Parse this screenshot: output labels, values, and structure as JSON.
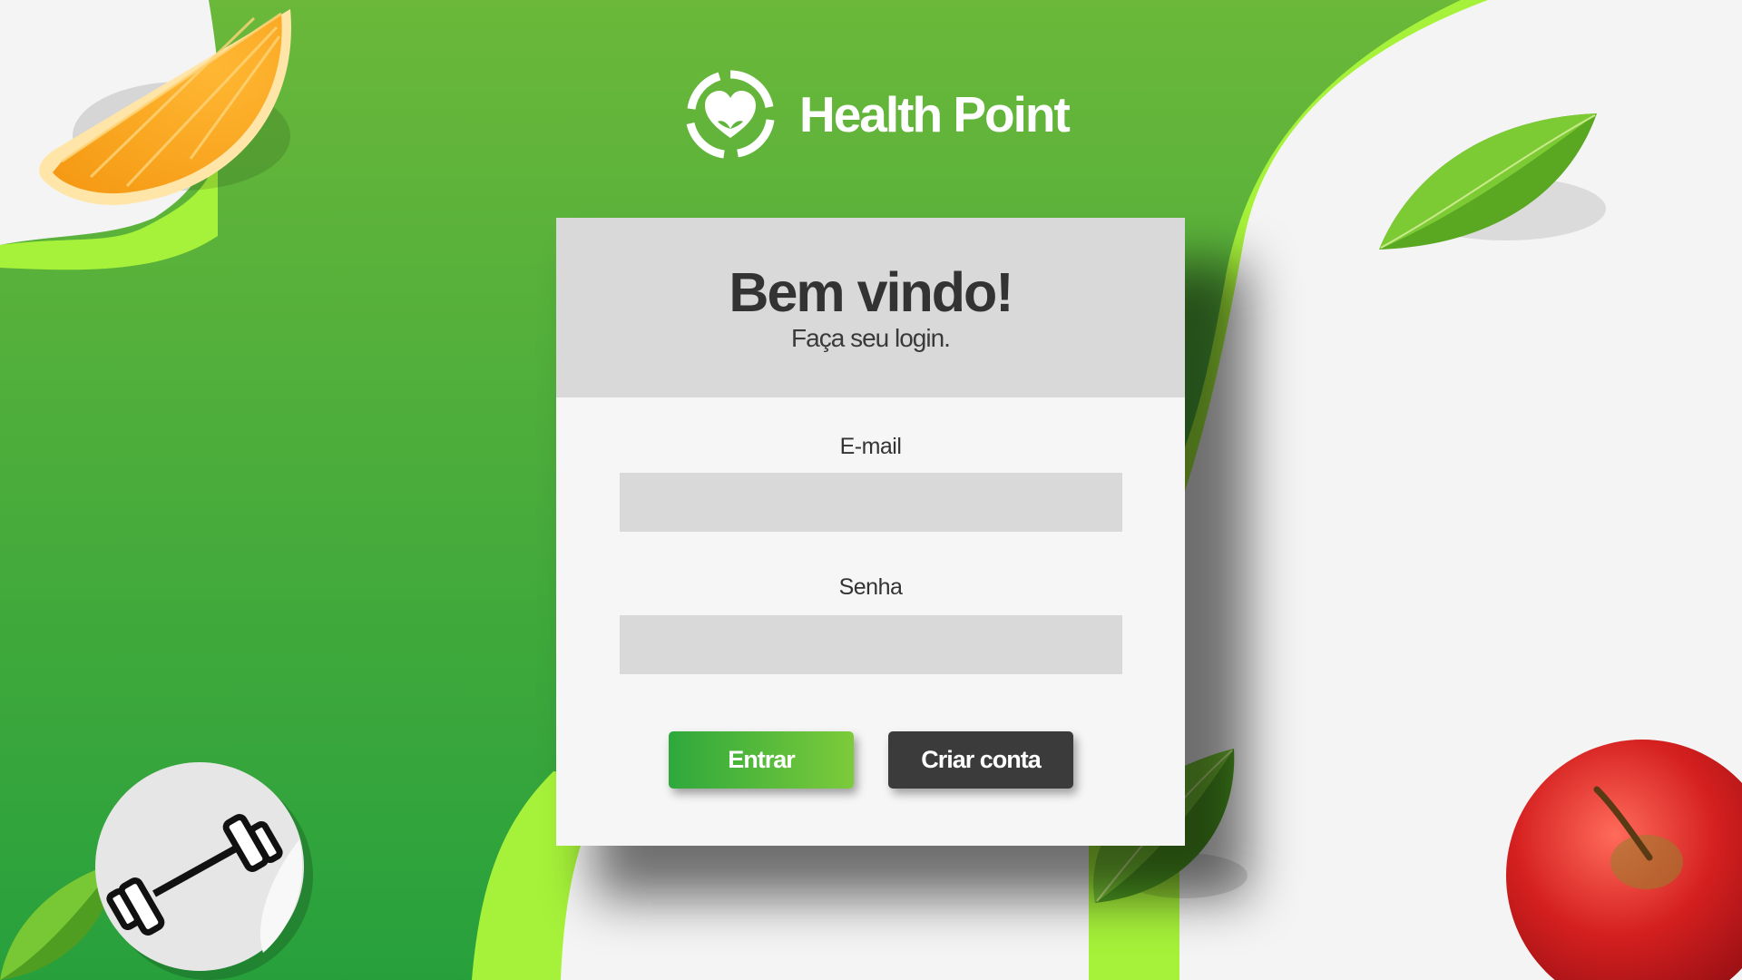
{
  "brand": {
    "name": "Health Point"
  },
  "login": {
    "title": "Bem vindo!",
    "subtitle": "Faça seu login.",
    "email_label": "E-mail",
    "email_value": "",
    "password_label": "Senha",
    "password_value": "",
    "submit_label": "Entrar",
    "create_account_label": "Criar conta"
  },
  "colors": {
    "green_primary": "#3fa63c",
    "green_light": "#a7f03a",
    "card_header": "#d9d9d9",
    "card_body": "#f6f6f6",
    "dark_button": "#3b3b3b",
    "title_text": "#333333"
  },
  "icons": {
    "logo": "heart-leaf-ring-icon",
    "sticker": "dumbbell-icon"
  }
}
